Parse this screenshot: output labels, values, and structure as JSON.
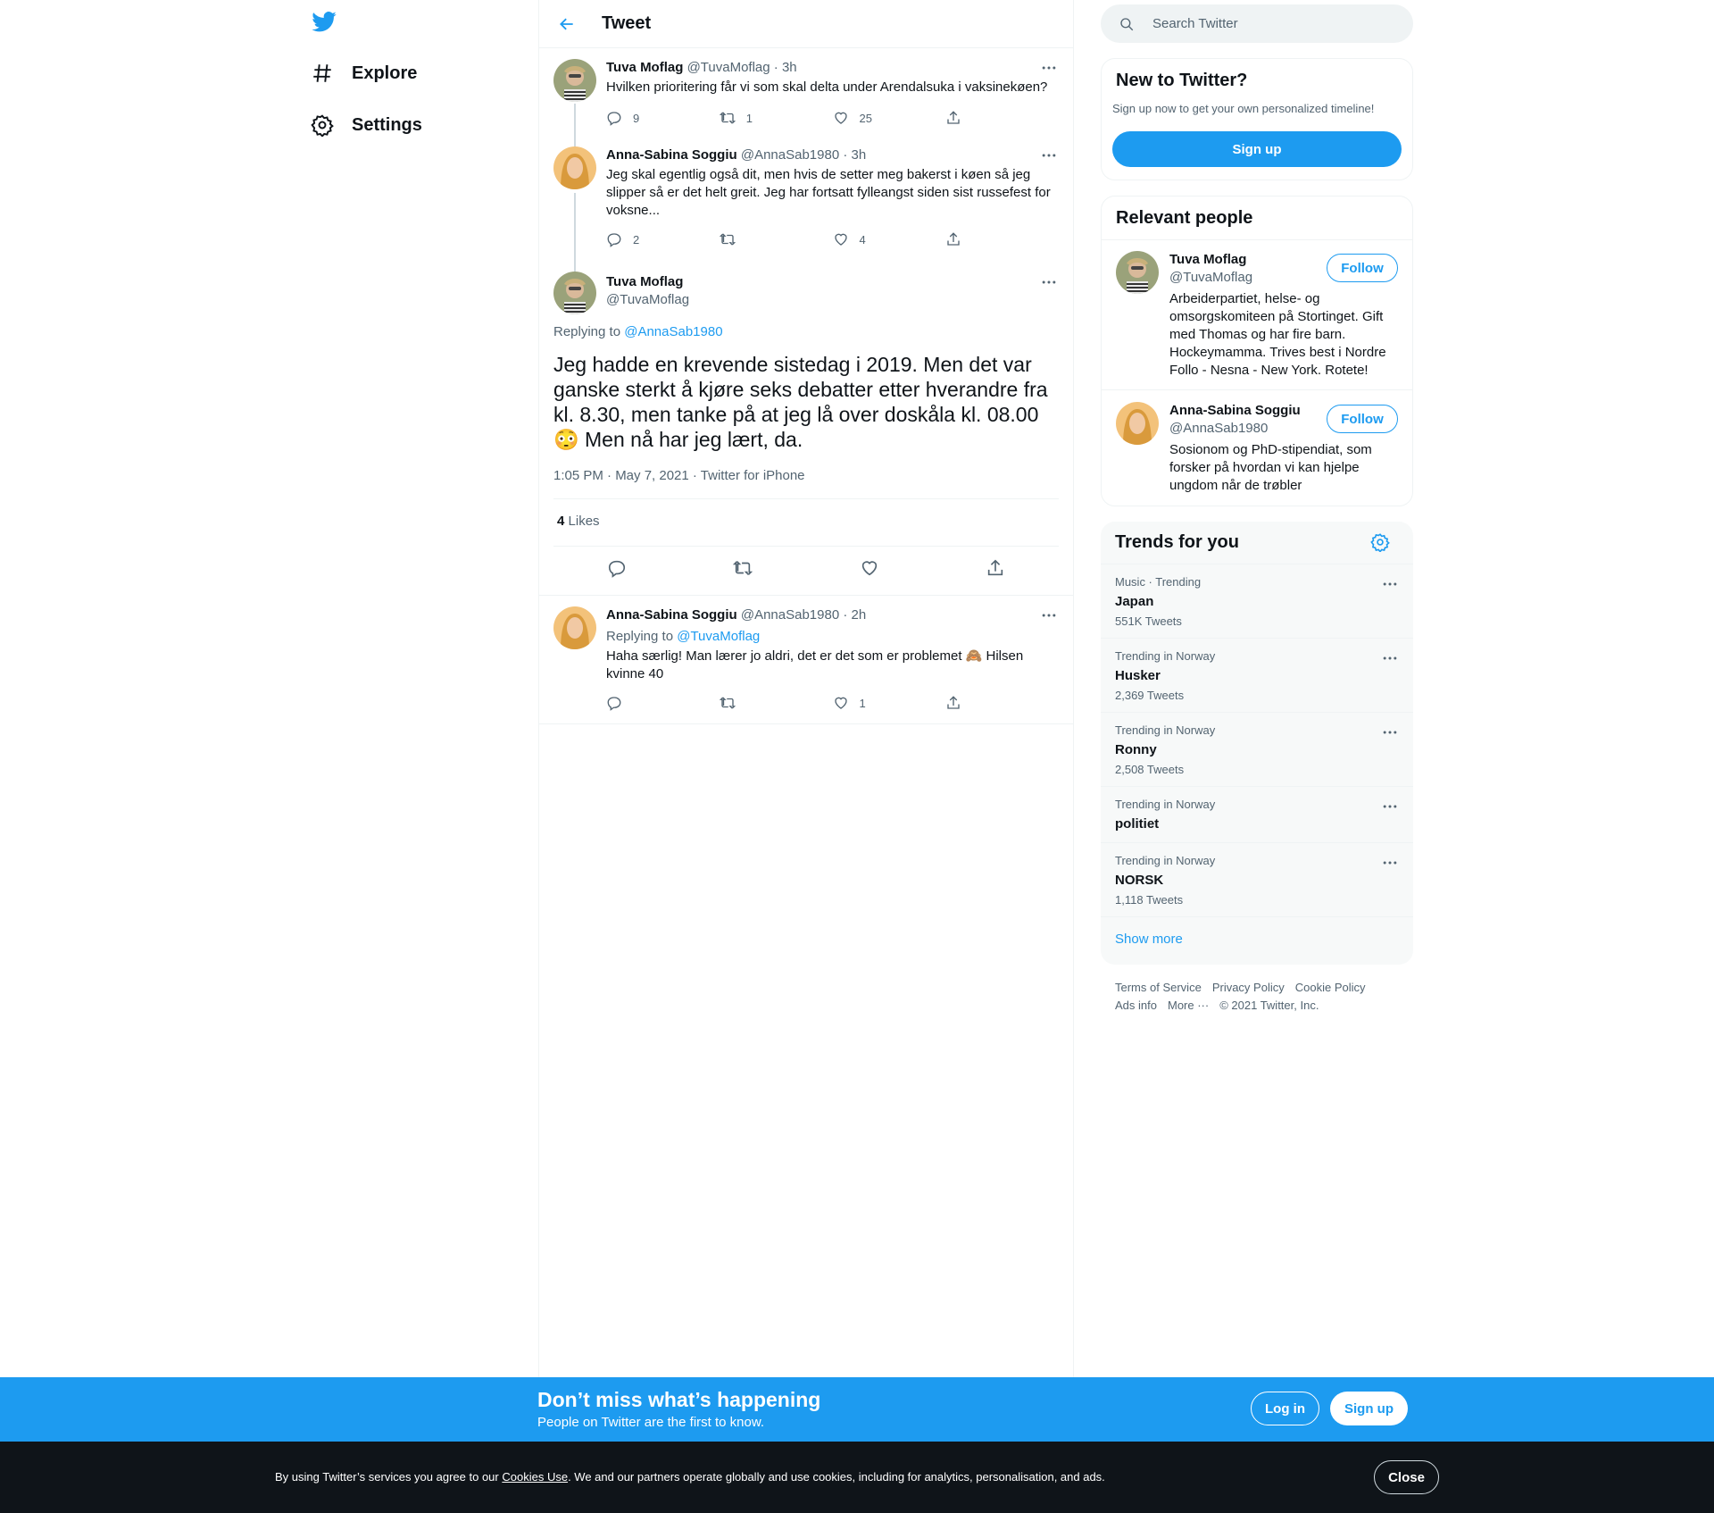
{
  "nav": {
    "logo": "twitter-bird",
    "items": [
      {
        "label": "Explore",
        "icon": "hashtag-icon"
      },
      {
        "label": "Settings",
        "icon": "gear-icon"
      }
    ]
  },
  "header": {
    "title": "Tweet"
  },
  "thread": [
    {
      "name": "Tuva Moflag",
      "handle": "@TuvaMoflag",
      "time": "· 3h",
      "text": "Hvilken prioritering får vi som skal delta under Arendalsuka i vaksinekøen?",
      "replies": "9",
      "retweets": "1",
      "likes": "25"
    },
    {
      "name": "Anna-Sabina Soggiu",
      "handle": "@AnnaSab1980",
      "time": "· 3h",
      "text": "Jeg skal egentlig også dit, men hvis de setter meg bakerst i køen så jeg slipper så er det helt greit. Jeg har fortsatt fylleangst siden sist russefest for voksne...",
      "replies": "2",
      "retweets": "",
      "likes": "4"
    }
  ],
  "focus": {
    "name": "Tuva Moflag",
    "handle": "@TuvaMoflag",
    "replying_prefix": "Replying to ",
    "replying_to": "@AnnaSab1980",
    "text": "Jeg hadde en krevende sistedag i 2019. Men det var ganske sterkt å kjøre seks debatter etter hverandre fra kl. 8.30, men tanke på at jeg lå over doskåla kl. 08.00 😳 Men nå har jeg lært, da.",
    "timestamp": "1:05 PM · May 7, 2021 · Twitter for iPhone",
    "likes_count": "4",
    "likes_label": "Likes"
  },
  "reply": {
    "name": "Anna-Sabina Soggiu",
    "handle": "@AnnaSab1980",
    "time": "· 2h",
    "replying_prefix": "Replying to ",
    "replying_to": "@TuvaMoflag",
    "text": "Haha særlig! Man lærer jo aldri, det er det som er problemet 🙈 Hilsen kvinne 40",
    "replies": "",
    "retweets": "",
    "likes": "1"
  },
  "search": {
    "placeholder": "Search Twitter"
  },
  "new_to_twitter": {
    "title": "New to Twitter?",
    "subtitle": "Sign up now to get your own personalized timeline!",
    "button": "Sign up"
  },
  "relevant": {
    "title": "Relevant people",
    "people": [
      {
        "name": "Tuva Moflag",
        "handle": "@TuvaMoflag",
        "follow": "Follow",
        "bio": "Arbeiderpartiet, helse- og omsorgskomiteen på Stortinget. Gift med Thomas og har fire barn. Hockeymamma. Trives best i Nordre Follo - Nesna - New York. Rotete!"
      },
      {
        "name": "Anna-Sabina Soggiu",
        "handle": "@AnnaSab1980",
        "follow": "Follow",
        "bio": "Sosionom og PhD-stipendiat, som forsker på hvordan vi kan hjelpe ungdom når de trøbler"
      }
    ]
  },
  "trends": {
    "title": "Trends for you",
    "items": [
      {
        "context": "Music · Trending",
        "name": "Japan",
        "count": "551K Tweets"
      },
      {
        "context": "Trending in Norway",
        "name": "Husker",
        "count": "2,369 Tweets"
      },
      {
        "context": "Trending in Norway",
        "name": "Ronny",
        "count": "2,508 Tweets"
      },
      {
        "context": "Trending in Norway",
        "name": "politiet",
        "count": ""
      },
      {
        "context": "Trending in Norway",
        "name": "NORSK",
        "count": "1,118 Tweets"
      }
    ],
    "show_more": "Show more"
  },
  "footer": {
    "links": [
      "Terms of Service",
      "Privacy Policy",
      "Cookie Policy",
      "Ads info",
      "More ···",
      "© 2021 Twitter, Inc."
    ]
  },
  "banner": {
    "title": "Don’t miss what’s happening",
    "subtitle": "People on Twitter are the first to know.",
    "login": "Log in",
    "signup": "Sign up"
  },
  "cookie": {
    "text_before": "By using Twitter’s services you agree to our ",
    "link": "Cookies Use",
    "text_after": ". We and our partners operate globally and use cookies, including for analytics, personalisation, and ads.",
    "close": "Close"
  },
  "colors": {
    "accent": "#1d9bf0",
    "text": "#0f1419",
    "muted": "#536471",
    "dark": "#0f1419"
  }
}
